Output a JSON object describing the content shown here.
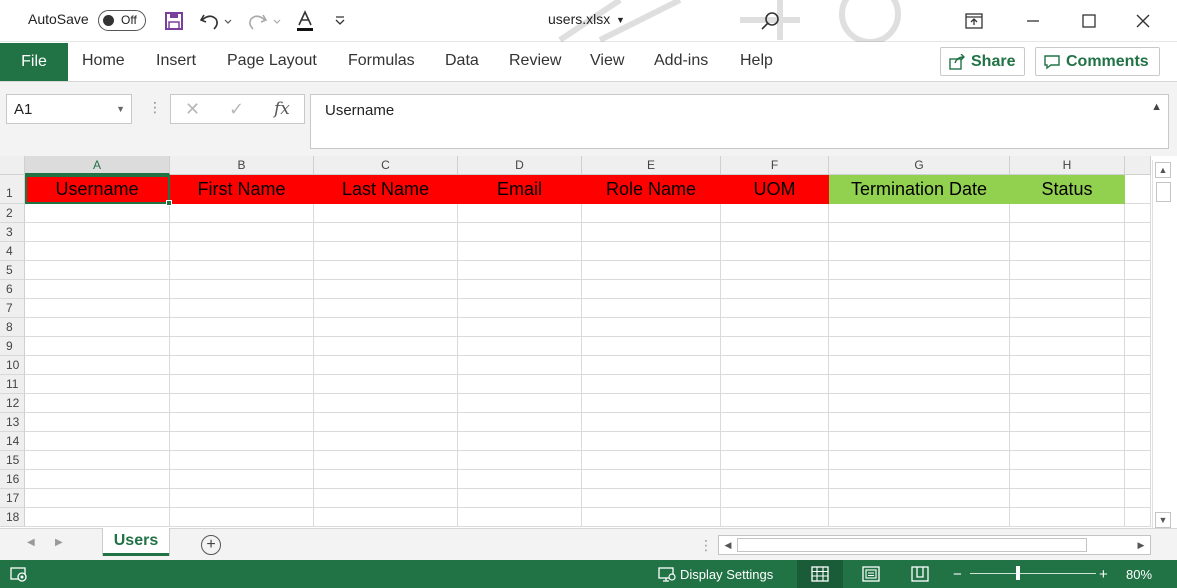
{
  "app": {
    "autosave_label": "AutoSave",
    "autosave_state": "Off",
    "file_name": "users.xlsx",
    "accent_color": "#217346"
  },
  "ribbon": {
    "tabs": [
      "File",
      "Home",
      "Insert",
      "Page Layout",
      "Formulas",
      "Data",
      "Review",
      "View",
      "Add-ins",
      "Help"
    ],
    "share_label": "Share",
    "comments_label": "Comments"
  },
  "formula_bar": {
    "name_box": "A1",
    "content": "Username"
  },
  "grid": {
    "columns": [
      "A",
      "B",
      "C",
      "D",
      "E",
      "F",
      "G",
      "H"
    ],
    "rows": [
      "1",
      "2",
      "3",
      "4",
      "5",
      "6",
      "7",
      "8",
      "9",
      "10",
      "11",
      "12",
      "13",
      "14",
      "15",
      "16",
      "17",
      "18"
    ],
    "header_row": [
      {
        "text": "Username",
        "fill": "#ff0000"
      },
      {
        "text": "First Name",
        "fill": "#ff0000"
      },
      {
        "text": "Last Name",
        "fill": "#ff0000"
      },
      {
        "text": "Email",
        "fill": "#ff0000"
      },
      {
        "text": "Role Name",
        "fill": "#ff0000"
      },
      {
        "text": "UOM",
        "fill": "#ff0000"
      },
      {
        "text": "Termination Date",
        "fill": "#92d050"
      },
      {
        "text": "Status",
        "fill": "#92d050"
      }
    ],
    "active_cell": "A1"
  },
  "sheets": {
    "tabs": [
      "Users"
    ],
    "active": "Users"
  },
  "status_bar": {
    "display_settings": "Display Settings",
    "zoom": "80%",
    "zoom_minus": "−",
    "zoom_plus": "+"
  },
  "icons": [
    "save-icon",
    "undo-icon",
    "redo-icon",
    "font-color-icon",
    "customize-qat-icon",
    "search-icon",
    "ribbon-display-icon",
    "minimize-icon",
    "maximize-icon",
    "close-icon",
    "share-icon",
    "comment-icon",
    "cancel-icon",
    "enter-icon",
    "fx-icon",
    "add-sheet-icon",
    "normal-view-icon",
    "page-layout-view-icon",
    "page-break-view-icon",
    "display-settings-icon",
    "macro-record-icon"
  ]
}
